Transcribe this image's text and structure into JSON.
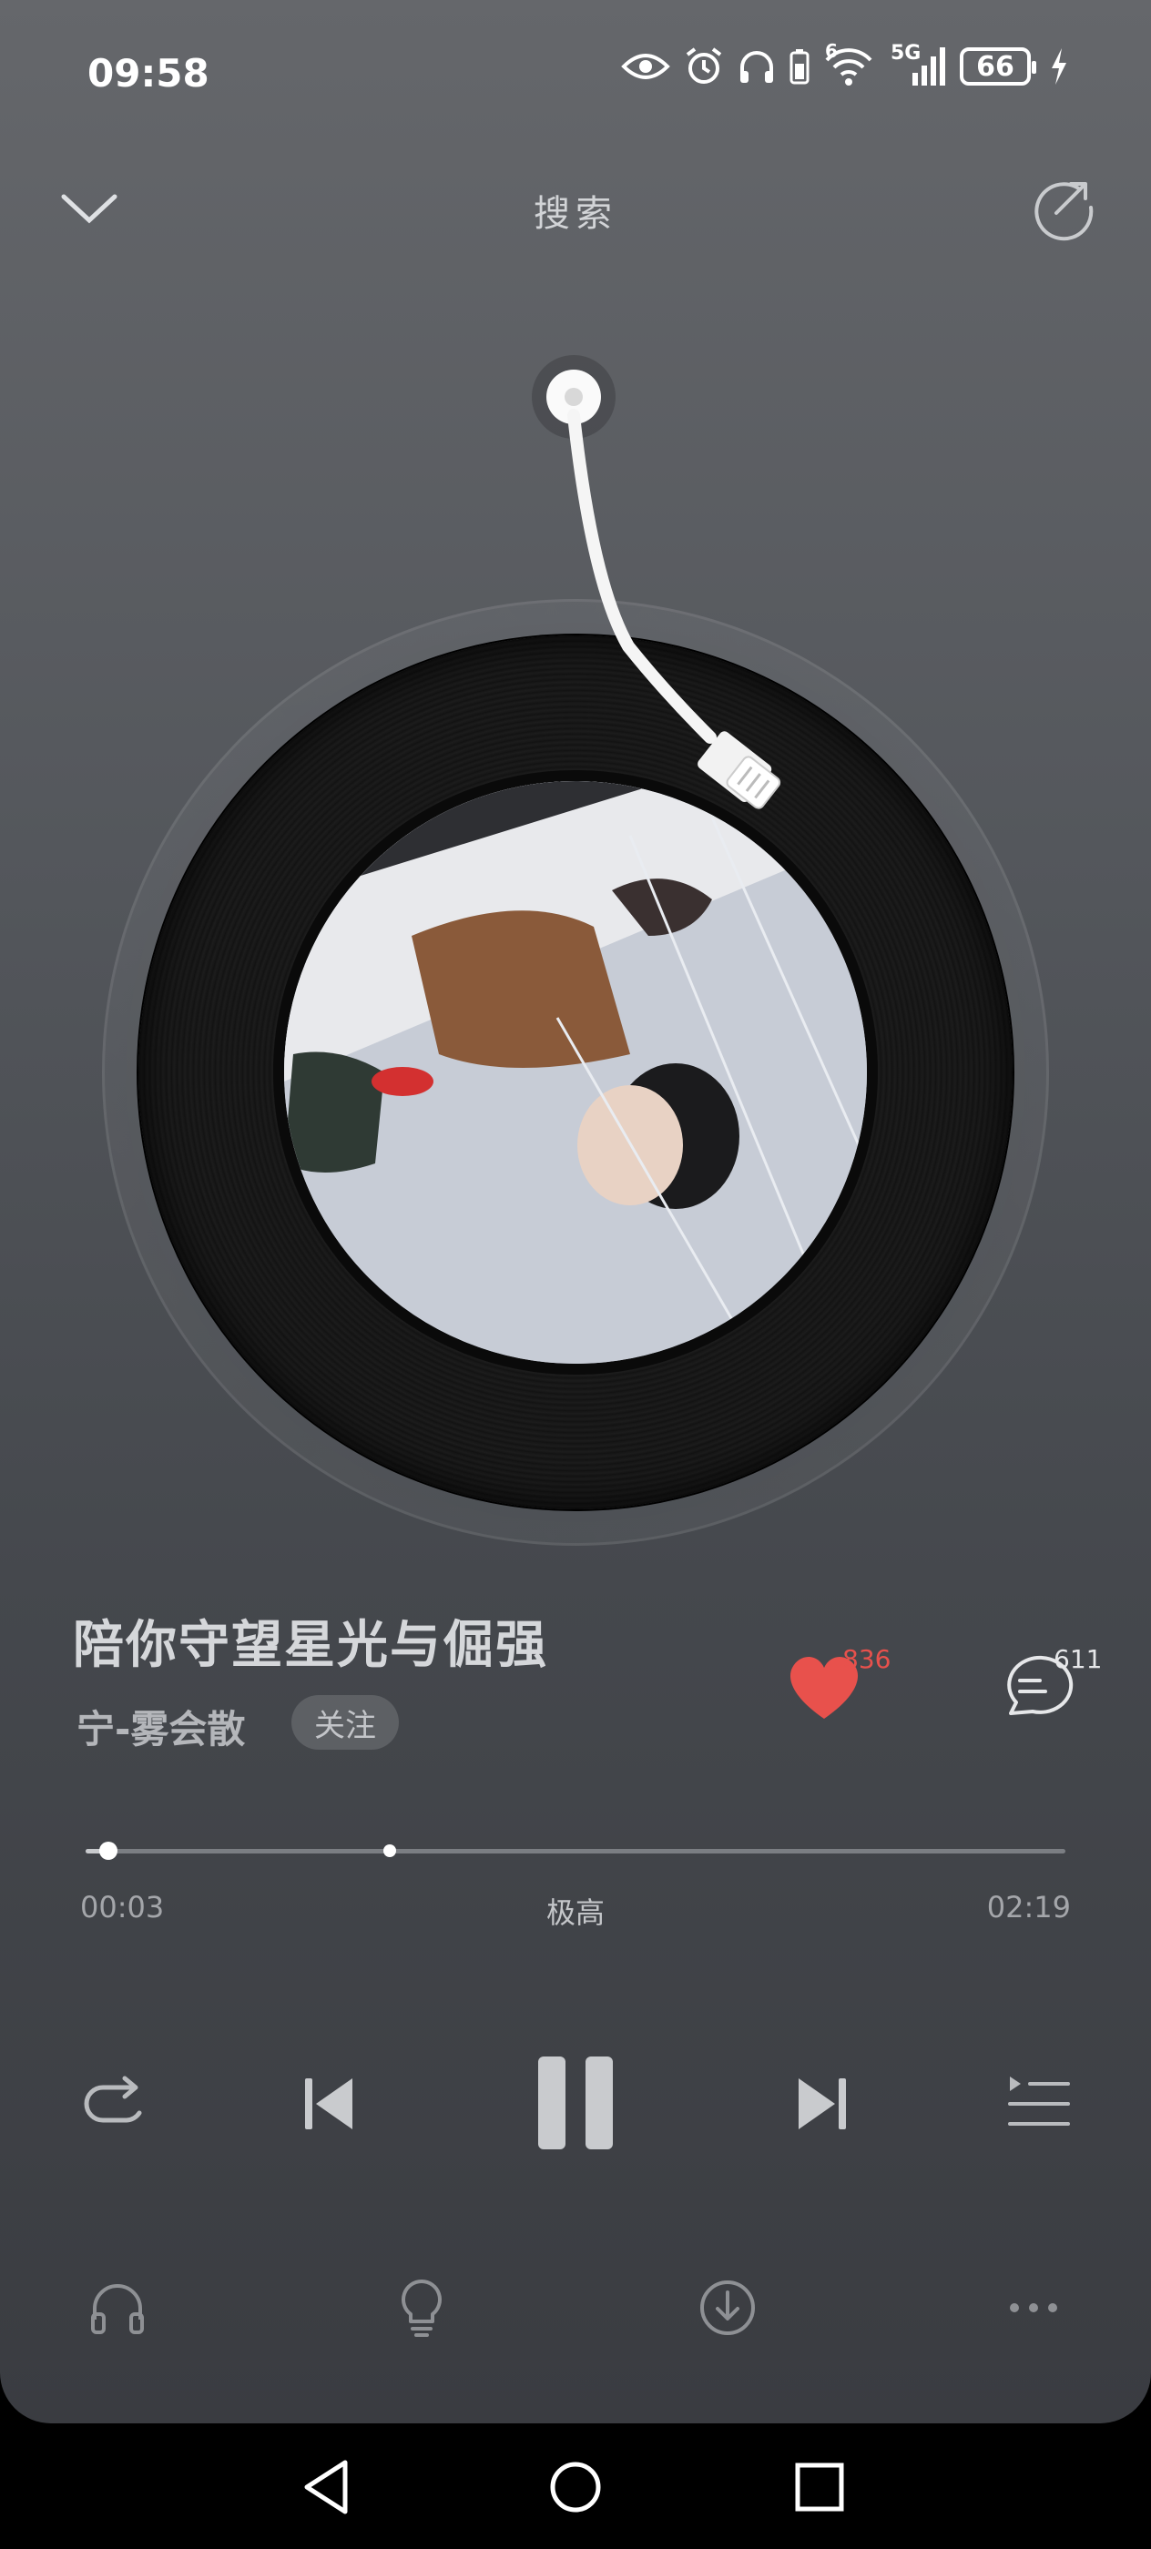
{
  "status_bar": {
    "time": "09:58",
    "icons": [
      "eye-icon",
      "alarm-icon",
      "headphones-icon",
      "battery-small-icon",
      "wifi-6-icon",
      "5g-signal-icon",
      "battery-icon",
      "charging-icon"
    ],
    "wifi_label": "6",
    "network_label": "5G",
    "battery_level": "66"
  },
  "header": {
    "title": "搜索",
    "left_icon": "chevron-down-icon",
    "right_icon": "share-icon"
  },
  "song": {
    "title": "陪你守望星光与倔强",
    "artist": "宁-雾会散",
    "follow_label": "关注",
    "like_count": "836",
    "comment_count": "611",
    "liked": true,
    "accent_color": "#e8514c"
  },
  "playback": {
    "current_time": "00:03",
    "total_time": "02:19",
    "quality": "极高",
    "progress_fraction": 0.023,
    "buffer_fraction": 0.31,
    "state": "playing"
  },
  "controls": [
    "repeat-icon",
    "previous-icon",
    "pause-icon",
    "next-icon",
    "playlist-icon"
  ],
  "actions": [
    "headphones-icon",
    "lightbulb-icon",
    "download-icon",
    "more-icon"
  ],
  "system_nav": [
    "back-icon",
    "home-icon",
    "recents-icon"
  ]
}
